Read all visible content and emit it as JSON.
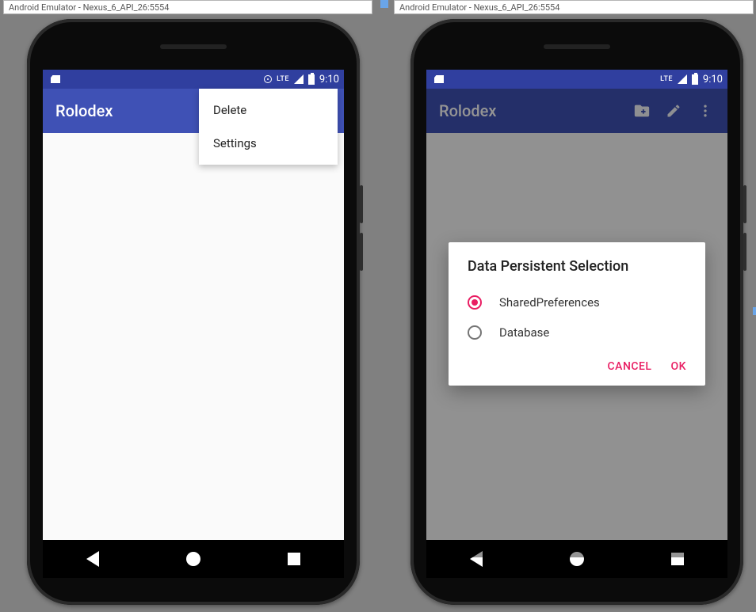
{
  "emulator": {
    "window_title_left": "Android Emulator - Nexus_6_API_26:5554",
    "window_title_right": "Android Emulator - Nexus_6_API_26:5554"
  },
  "status": {
    "lte_label": "LTE",
    "clock": "9:10"
  },
  "app": {
    "title": "Rolodex"
  },
  "overflow_menu": {
    "items": [
      "Delete",
      "Settings"
    ]
  },
  "dialog": {
    "title": "Data Persistent Selection",
    "options": [
      {
        "label": "SharedPreferences",
        "checked": true
      },
      {
        "label": "Database",
        "checked": false
      }
    ],
    "cancel_label": "CANCEL",
    "ok_label": "OK"
  },
  "icons": {
    "new_folder": "new-folder-add-icon",
    "edit": "pencil-icon",
    "overflow": "more-vert-icon",
    "location": "location-pin-icon",
    "card": "sd-card-icon",
    "signal": "signal-icon",
    "battery": "battery-charging-icon"
  },
  "colors": {
    "primary": "#3F51B5",
    "primary_dark": "#303F9F",
    "accent": "#E91E63"
  }
}
